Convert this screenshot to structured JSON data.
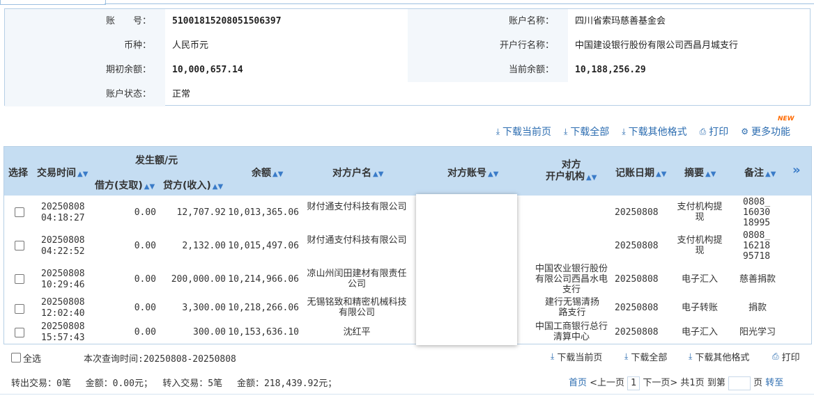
{
  "account": {
    "account_no_label": "账　　号：",
    "account_no": "51001815208051506397",
    "account_name_label": "账户名称：",
    "account_name": "四川省索玛慈善基金会",
    "currency_label": "币种：",
    "currency": "人民币元",
    "bank_label": "开户行名称：",
    "bank": "中国建设银行股份有限公司西昌月城支行",
    "opening_balance_label": "期初余额：",
    "opening_balance": "10,000,657.14",
    "current_balance_label": "当前余额：",
    "current_balance": "10,188,256.29",
    "status_label": "账户状态：",
    "status": "正常"
  },
  "toolbar": {
    "download_page": "下载当前页",
    "download_all": "下载全部",
    "download_other": "下载其他格式",
    "print": "打印",
    "more": "更多功能",
    "new_badge": "NEW"
  },
  "table": {
    "headers": {
      "select": "选择",
      "time": "交易时间",
      "amount_group": "发生额/元",
      "debit": "借方(支取)",
      "credit": "贷方(收入)",
      "balance": "余额",
      "counterparty_name": "对方户名",
      "counterparty_account": "对方账号",
      "counterparty_bank": "对方开户机构",
      "counterparty_bank_l1": "对方",
      "counterparty_bank_l2": "开户机构",
      "post_date": "记账日期",
      "summary": "摘要",
      "remark": "备注",
      "more_cols": "»"
    },
    "rows": [
      {
        "date": "20250808",
        "time": "04:18:27",
        "debit": "0.00",
        "credit": "12,707.92",
        "balance": "10,013,365.06",
        "name": "财付通支付科技有限公司",
        "bank": "",
        "post": "20250808",
        "summary": "支付机构提现",
        "remark": "0808_1603018995"
      },
      {
        "date": "20250808",
        "time": "04:22:52",
        "debit": "0.00",
        "credit": "2,132.00",
        "balance": "10,015,497.06",
        "name": "财付通支付科技有限公司",
        "bank": "",
        "post": "20250808",
        "summary": "支付机构提现",
        "remark": "0808_1621895718"
      },
      {
        "date": "20250808",
        "time": "10:29:46",
        "debit": "0.00",
        "credit": "200,000.00",
        "balance": "10,214,966.06",
        "name": "凉山州闰田建材有限责任公司",
        "bank": "中国农业银行股份有限公司西昌水电支行",
        "post": "20250808",
        "summary": "电子汇入",
        "remark": "慈善捐款"
      },
      {
        "date": "20250808",
        "time": "12:02:40",
        "debit": "0.00",
        "credit": "3,300.00",
        "balance": "10,218,266.06",
        "name": "无锡铭致和精密机械科技有限公司",
        "bank": "建行无锡清扬路支行",
        "post": "20250808",
        "summary": "电子转账",
        "remark": "捐款"
      },
      {
        "date": "20250808",
        "time": "15:57:43",
        "debit": "0.00",
        "credit": "300.00",
        "balance": "10,153,636.10",
        "name": "沈红平",
        "bank": "中国工商银行总行清算中心",
        "post": "20250808",
        "summary": "电子汇入",
        "remark": "阳光学习"
      }
    ]
  },
  "footer": {
    "select_all": "全选",
    "query_time": "本次查询时间:20250808-20250808",
    "download_page": "下载当前页",
    "download_all": "下载全部",
    "download_other": "下载其他格式",
    "print": "打印",
    "summary": "转出交易：0笔　 金额：0.00元；　 转入交易：5笔　 金额：218,439.92元；",
    "first": "首页",
    "prev": "<上一页",
    "page": "1",
    "next": "下一页>",
    "total": "共1页",
    "goto": "到第",
    "page_unit": "页",
    "go": "转至"
  }
}
